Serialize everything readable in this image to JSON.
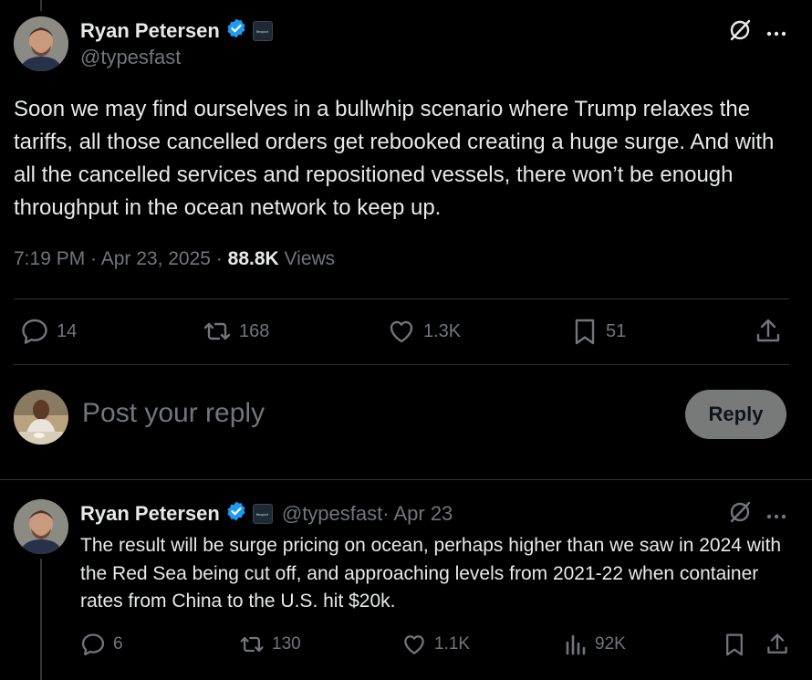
{
  "main_post": {
    "author_name": "Ryan Petersen",
    "author_handle": "@typesfast",
    "affiliate_badge": "flexport",
    "text": "Soon we may find ourselves in a bullwhip scenario where Trump relaxes the tariffs, all those cancelled orders get rebooked creating a huge surge. And with all the cancelled services and repositioned vessels, there won’t be enough throughput in the ocean network to keep up.",
    "time": "7:19 PM · Apr 23, 2025 · ",
    "views_count": "88.8K",
    "views_label": " Views",
    "stats": {
      "replies": "14",
      "reposts": "168",
      "likes": "1.3K",
      "bookmarks": "51"
    }
  },
  "composer": {
    "placeholder": "Post your reply",
    "button_label": "Reply"
  },
  "reply_post": {
    "author_name": "Ryan Petersen",
    "author_handle": "@typesfast",
    "date": " · Apr 23",
    "affiliate_badge": "flexport",
    "text": "The result will be surge pricing on ocean, perhaps higher than we saw in 2024 with the Red Sea being cut off, and approaching levels from 2021-22 when container rates from China to the U.S. hit $20k.",
    "stats": {
      "replies": "6",
      "reposts": "130",
      "likes": "1.1K",
      "views": "92K"
    }
  },
  "icons": [
    "verified-icon",
    "grok-icon",
    "more-icon",
    "reply-icon",
    "repost-icon",
    "like-icon",
    "bookmark-icon",
    "share-icon",
    "views-icon"
  ],
  "colors": {
    "background": "#000000",
    "text": "#e7e9ea",
    "muted": "#71767b",
    "verified": "#1d9bf0",
    "divider": "#2f3336",
    "reply_button": "#787a7a"
  }
}
